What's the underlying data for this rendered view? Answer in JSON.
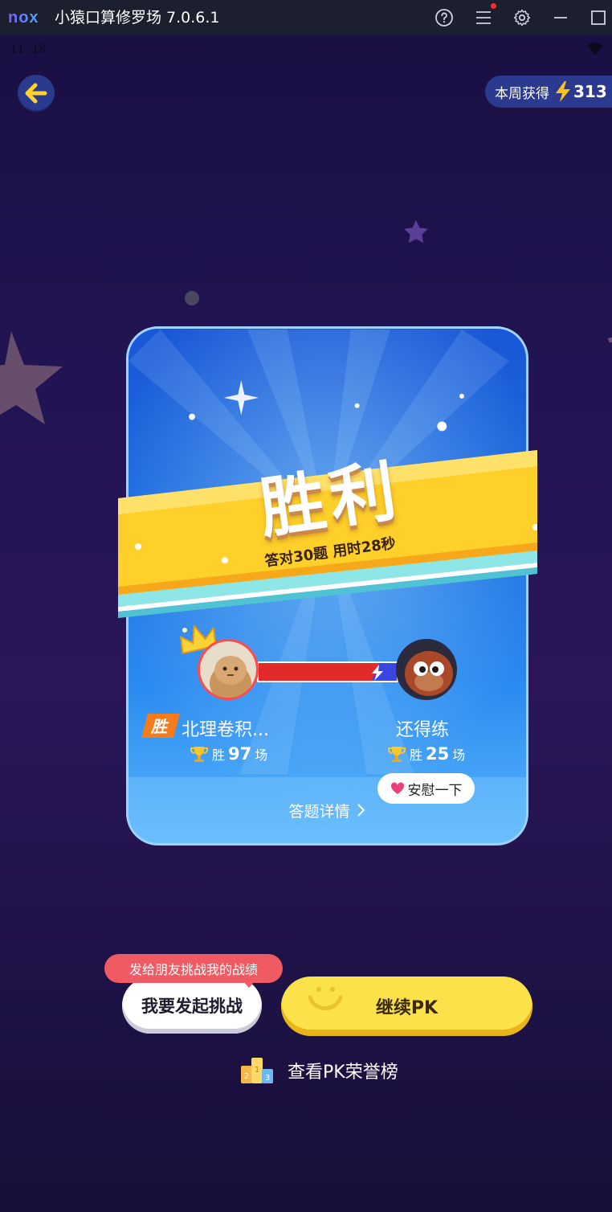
{
  "window": {
    "logo": "nox",
    "title": "小猿口算修罗场 7.0.6.1",
    "icons": [
      "help-icon",
      "menu-icon",
      "gear-icon",
      "minimize-icon",
      "maximize-icon"
    ]
  },
  "status_bar": {
    "time": "11:18"
  },
  "header": {
    "back_icon": "back-arrow-icon",
    "week_label": "本周获得",
    "week_icon": "lightning-icon",
    "week_value": "313"
  },
  "result_card": {
    "title": "胜利",
    "subtitle": "答对30题 用时28秒",
    "winner_badge": "胜",
    "player_left": {
      "name": "北理卷积...",
      "wins_prefix": "胜",
      "wins_count": "97",
      "wins_suffix": "场"
    },
    "player_right": {
      "name": "还得练",
      "wins_prefix": "胜",
      "wins_count": "25",
      "wins_suffix": "场"
    },
    "console_button": "安慰一下",
    "details_link": "答题详情"
  },
  "actions": {
    "tip": "发给朋友挑战我的战绩",
    "challenge_button": "我要发起挑战",
    "continue_button": "继续PK",
    "honor_link": "查看PK荣誉榜"
  },
  "colors": {
    "accent_yellow": "#fce24a",
    "card_blue": "#1d6fe0",
    "tip_red": "#ef5a63",
    "bar_red": "#e22a2a",
    "bar_blue": "#3a46e0"
  }
}
